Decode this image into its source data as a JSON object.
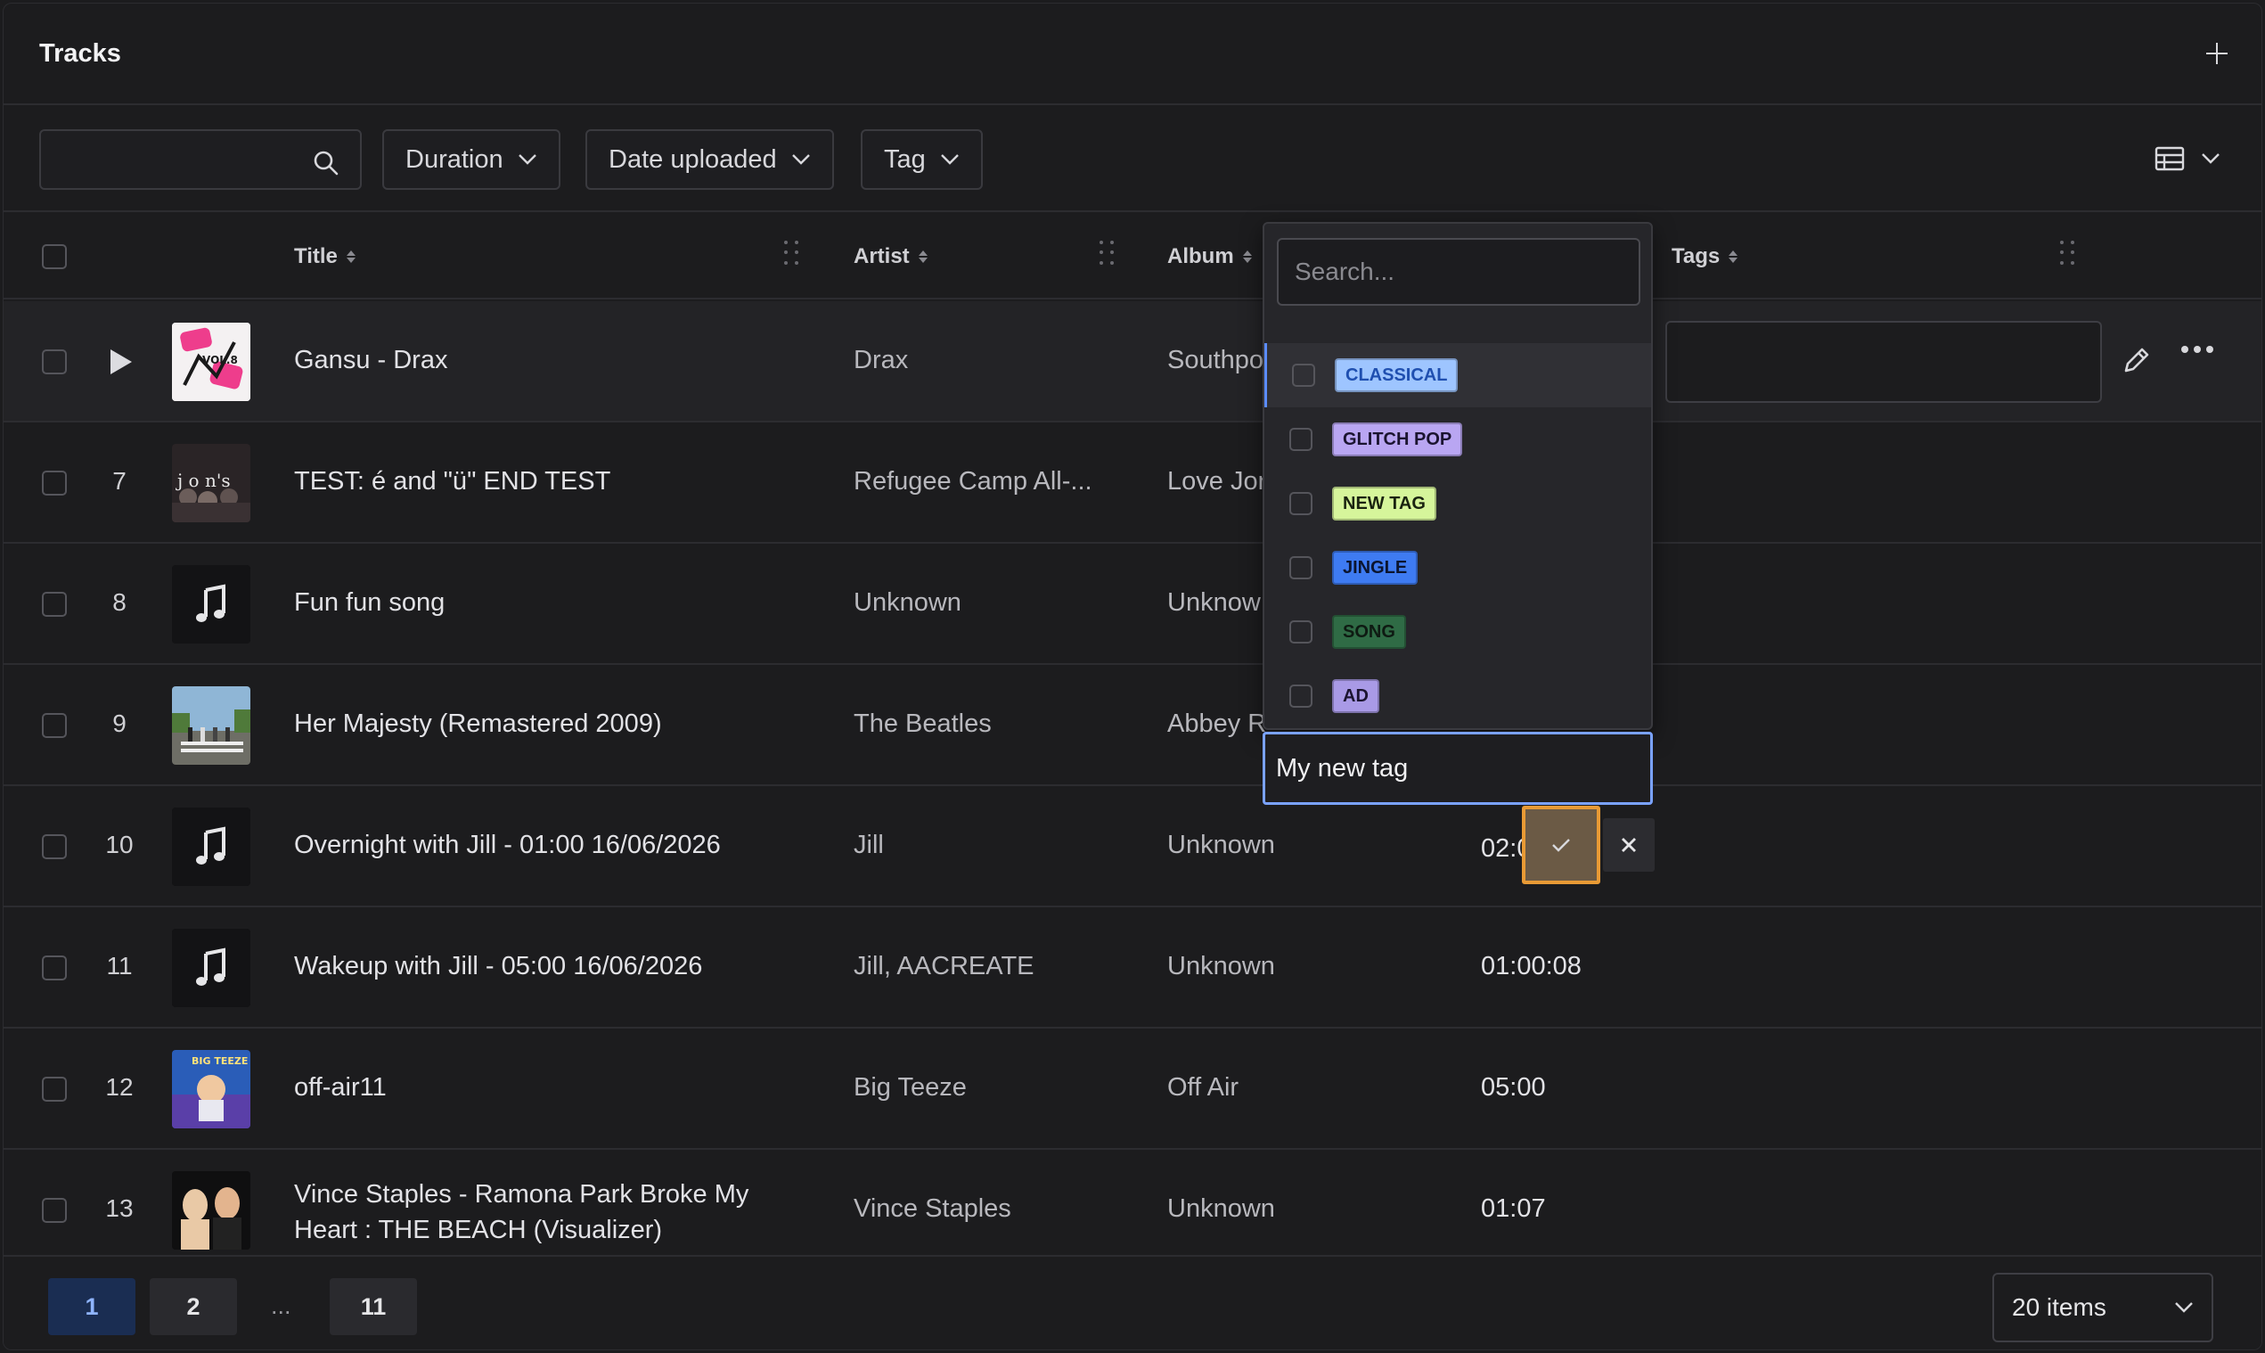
{
  "header": {
    "title": "Tracks",
    "add_icon": "plus-icon"
  },
  "toolbar": {
    "search_placeholder": "",
    "filters": [
      "Duration",
      "Date uploaded",
      "Tag"
    ],
    "view_icon": "table-view-icon"
  },
  "columns": [
    "Title",
    "Artist",
    "Album",
    "Tags"
  ],
  "rows": [
    {
      "num": "",
      "title": "Gansu - Drax",
      "artist": "Drax",
      "album": "Southpo",
      "duration": "",
      "cover": "pink-vol8",
      "playing": true
    },
    {
      "num": "7",
      "title": "TEST: é and \"ü\" END TEST",
      "artist": "Refugee Camp All-...",
      "album": "Love Jor",
      "duration": "",
      "cover": "crowd"
    },
    {
      "num": "8",
      "title": "Fun fun song",
      "artist": "Unknown",
      "album": "Unknow",
      "duration": "",
      "cover": "music-note"
    },
    {
      "num": "9",
      "title": "Her Majesty (Remastered 2009)",
      "artist": "The Beatles",
      "album": "Abbey R",
      "duration": "",
      "cover": "abbey-road"
    },
    {
      "num": "10",
      "title": "Overnight with Jill - 01:00 16/06/2026",
      "artist": "Jill",
      "album": "Unknown",
      "duration": "02:0",
      "cover": "music-note"
    },
    {
      "num": "11",
      "title": "Wakeup with Jill - 05:00 16/06/2026",
      "artist": "Jill, AACREATE",
      "album": "Unknown",
      "duration": "01:00:08",
      "cover": "music-note"
    },
    {
      "num": "12",
      "title": "off-air11",
      "artist": "Big Teeze",
      "album": "Off Air",
      "duration": "05:00",
      "cover": "big-teeze"
    },
    {
      "num": "13",
      "title": "Vince Staples - Ramona Park Broke My Heart : THE BEACH (Visualizer)",
      "artist": "Vince Staples",
      "album": "Unknown",
      "duration": "01:07",
      "cover": "vince"
    }
  ],
  "tag_dropdown": {
    "search_placeholder": "Search...",
    "tags": [
      {
        "label": "CLASSICAL",
        "bg": "#9ec5ff",
        "fg": "#1f4fb0"
      },
      {
        "label": "GLITCH POP",
        "bg": "#b9a6f2",
        "fg": "#1b1430"
      },
      {
        "label": "NEW TAG",
        "bg": "#d6f59b",
        "fg": "#1a2310"
      },
      {
        "label": "JINGLE",
        "bg": "#3e7bf2",
        "fg": "#0b1530"
      },
      {
        "label": "SONG",
        "bg": "#2f6b45",
        "fg": "#0e1a12"
      },
      {
        "label": "AD",
        "bg": "#a99ae6",
        "fg": "#1b1430"
      }
    ],
    "new_tag_value": "My new tag"
  },
  "pagination": {
    "pages": [
      "1",
      "2",
      "11"
    ],
    "ellipsis": "...",
    "current": "1",
    "page_size": "20 items"
  }
}
